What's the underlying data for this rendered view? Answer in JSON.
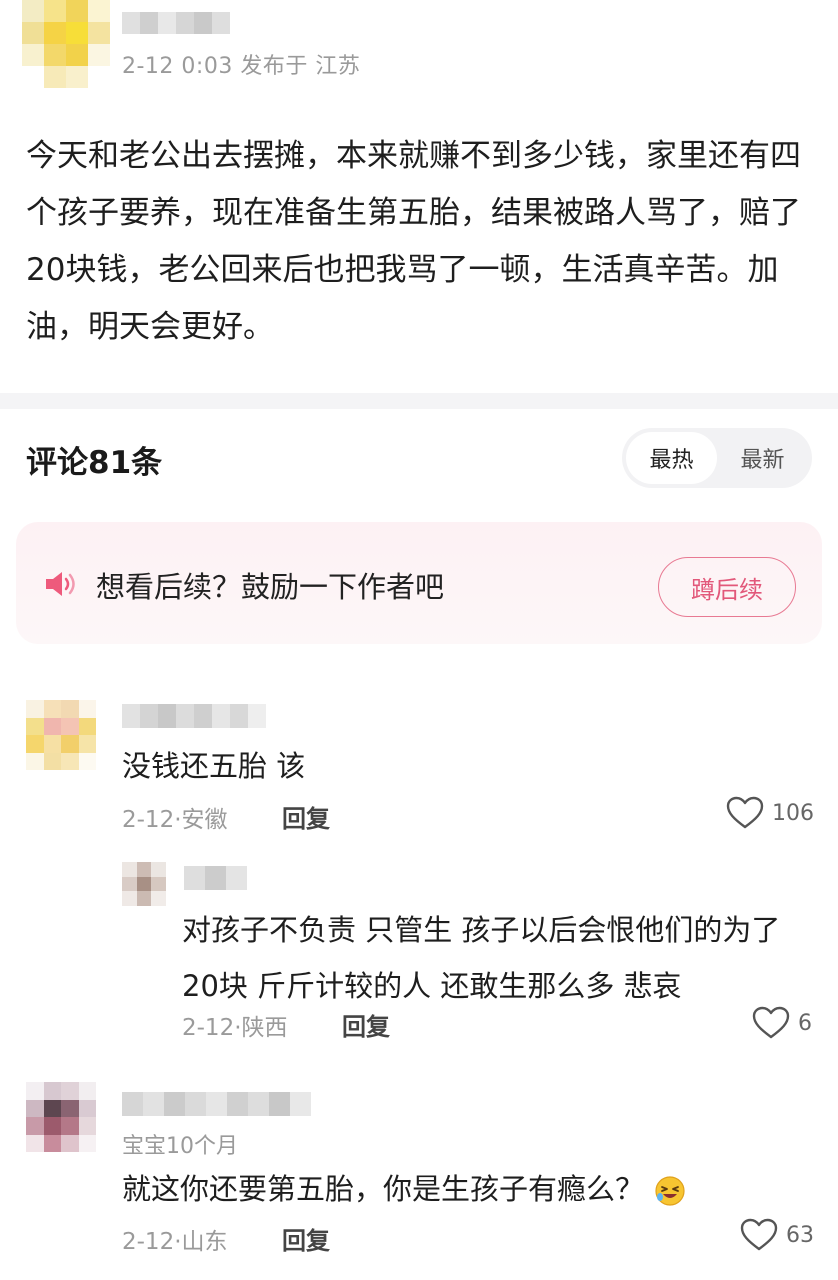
{
  "post": {
    "meta": "2-12 0:03  发布于 江苏",
    "body": "今天和老公出去摆摊，本来就赚不到多少钱，家里还有四个孩子要养，现在准备生第五胎，结果被路人骂了，赔了20块钱，老公回来后也把我骂了一顿，生活真辛苦。加油，明天会更好。"
  },
  "comments_section": {
    "title": "评论81条",
    "sort_hot": "最热",
    "sort_new": "最新"
  },
  "banner": {
    "text": "想看后续？鼓励一下作者吧",
    "button": "蹲后续"
  },
  "comments": [
    {
      "text": "没钱还五胎 该",
      "date_location": "2-12·安徽",
      "reply_label": "回复",
      "likes": "106"
    },
    {
      "text": "就这你还要第五胎，你是生孩子有瘾么？",
      "badge": "宝宝10个月",
      "date_location": "2-12·山东",
      "reply_label": "回复",
      "likes": "63"
    }
  ],
  "reply": {
    "text": "对孩子不负责 只管生  孩子以后会恨他们的为了20块 斤斤计较的人 还敢生那么多  悲哀",
    "date_location": "2-12·陕西",
    "reply_label": "回复",
    "likes": "6"
  },
  "colors": {
    "accent": "#e2587a",
    "meta": "#9a9a9a"
  },
  "icons": [
    "speaker-icon",
    "heart-icon",
    "laughing-emoji-icon"
  ]
}
